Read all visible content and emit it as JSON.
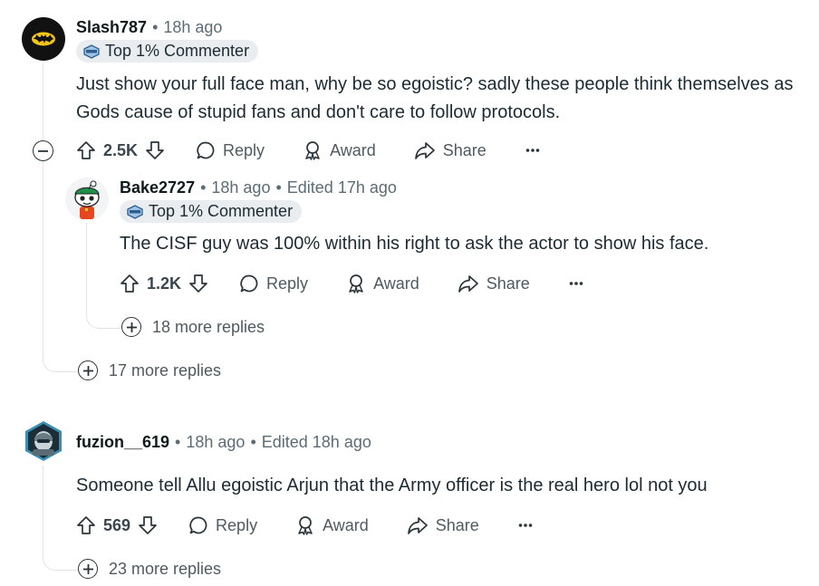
{
  "comments": [
    {
      "author": "Slash787",
      "time": "18h ago",
      "badge": "Top 1% Commenter",
      "body_lines": [
        "Just show your full face man, why be so egoistic? sadly these people think themselves as",
        "Gods cause of stupid fans and don't care to follow protocols."
      ],
      "score": "2.5K",
      "reply_label": "Reply",
      "award_label": "Award",
      "share_label": "Share",
      "more_replies": "17 more replies",
      "avatar_icon": "batman-logo-icon"
    },
    {
      "author": "Bake2727",
      "time": "18h ago",
      "edited": "Edited 17h ago",
      "badge": "Top 1% Commenter",
      "body_lines": [
        "The CISF guy was 100% within his right to ask the actor to show his face."
      ],
      "score": "1.2K",
      "reply_label": "Reply",
      "award_label": "Award",
      "share_label": "Share",
      "more_replies": "18 more replies",
      "avatar_icon": "snoo-avatar-icon"
    },
    {
      "author": "fuzion__619",
      "time": "18h ago",
      "edited": "Edited 18h ago",
      "body_lines": [
        "Someone tell Allu egoistic Arjun that the Army officer is the real hero lol not you"
      ],
      "score": "569",
      "reply_label": "Reply",
      "award_label": "Award",
      "share_label": "Share",
      "more_replies": "23 more replies",
      "avatar_icon": "hexagon-avatar-icon"
    }
  ],
  "colors": {
    "text": "#1c2b33",
    "meta": "#5c6c74",
    "badge_bg": "#eaedef",
    "thread_line": "#e0e4e6"
  }
}
